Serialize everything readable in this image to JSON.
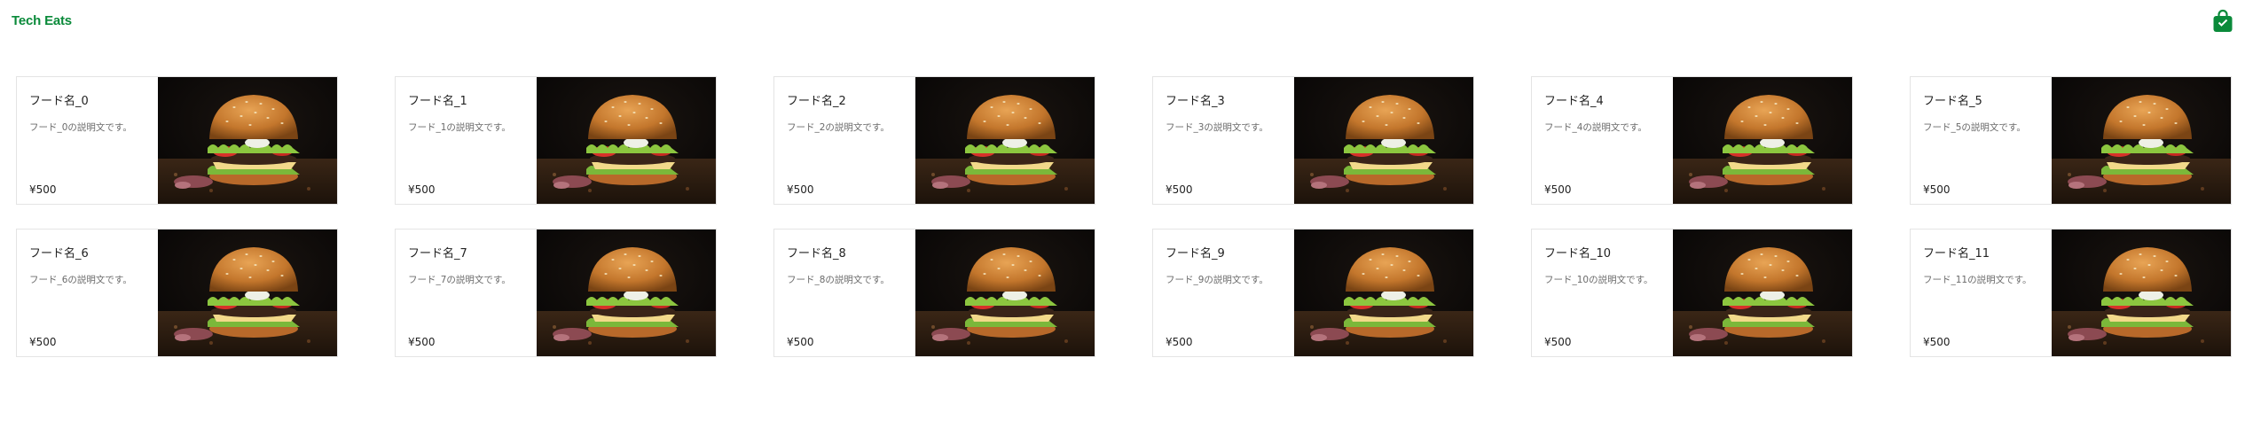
{
  "header": {
    "logo_text": "Tech Eats",
    "cart_icon": "shopping-bag-icon",
    "accent_color": "#0a8a3a"
  },
  "products": [
    {
      "name": "フード名_0",
      "description": "フード_0の説明文です。",
      "price": "¥500",
      "image": "hamburger-photo"
    },
    {
      "name": "フード名_1",
      "description": "フード_1の説明文です。",
      "price": "¥500",
      "image": "hamburger-photo"
    },
    {
      "name": "フード名_2",
      "description": "フード_2の説明文です。",
      "price": "¥500",
      "image": "hamburger-photo"
    },
    {
      "name": "フード名_3",
      "description": "フード_3の説明文です。",
      "price": "¥500",
      "image": "hamburger-photo"
    },
    {
      "name": "フード名_4",
      "description": "フード_4の説明文です。",
      "price": "¥500",
      "image": "hamburger-photo"
    },
    {
      "name": "フード名_5",
      "description": "フード_5の説明文です。",
      "price": "¥500",
      "image": "hamburger-photo"
    },
    {
      "name": "フード名_6",
      "description": "フード_6の説明文です。",
      "price": "¥500",
      "image": "hamburger-photo"
    },
    {
      "name": "フード名_7",
      "description": "フード_7の説明文です。",
      "price": "¥500",
      "image": "hamburger-photo"
    },
    {
      "name": "フード名_8",
      "description": "フード_8の説明文です。",
      "price": "¥500",
      "image": "hamburger-photo"
    },
    {
      "name": "フード名_9",
      "description": "フード_9の説明文です。",
      "price": "¥500",
      "image": "hamburger-photo"
    },
    {
      "name": "フード名_10",
      "description": "フード_10の説明文です。",
      "price": "¥500",
      "image": "hamburger-photo"
    },
    {
      "name": "フード名_11",
      "description": "フード_11の説明文です。",
      "price": "¥500",
      "image": "hamburger-photo"
    }
  ]
}
